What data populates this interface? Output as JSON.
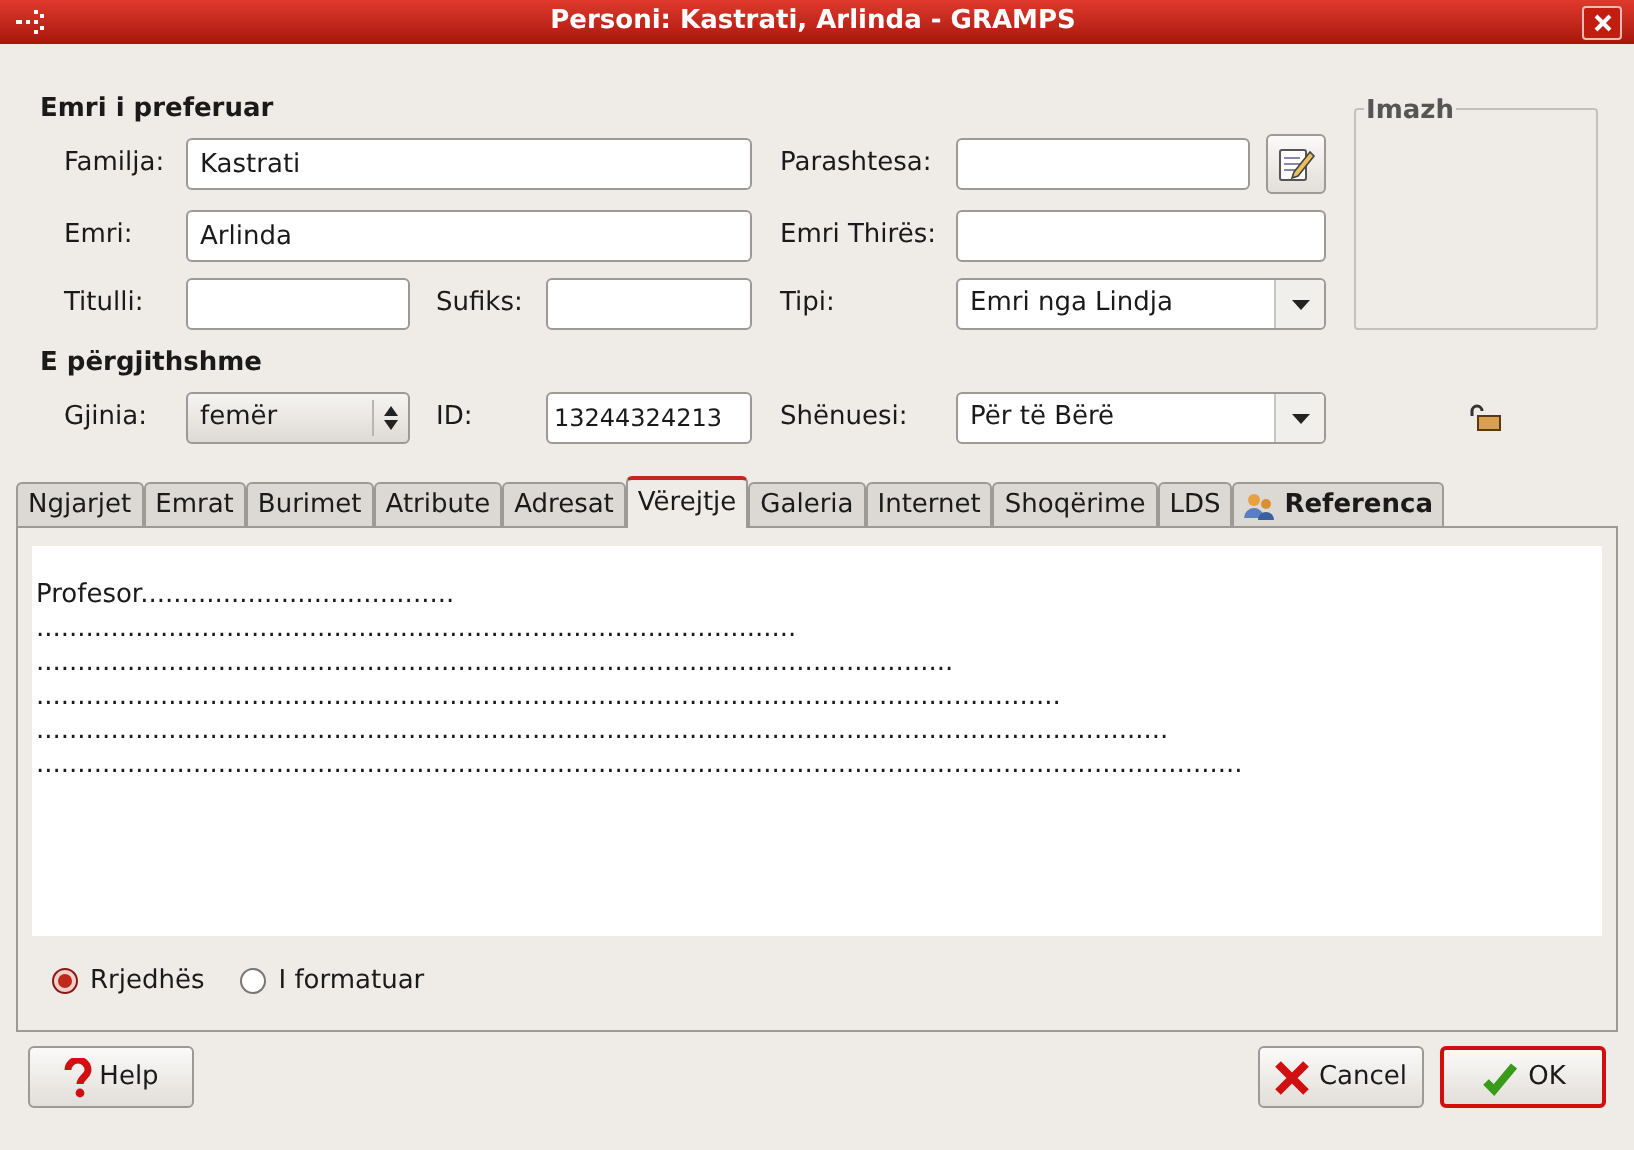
{
  "window": {
    "title": "Personi: Kastrati, Arlinda - GRAMPS"
  },
  "preferred_name": {
    "heading": "Emri i preferuar",
    "surname": {
      "label": "Familja:",
      "value": "Kastrati"
    },
    "prefix": {
      "label": "Parashtesa:"
    },
    "given": {
      "label": "Emri:",
      "value": "Arlinda"
    },
    "call_name": {
      "label": "Emri Thirës:"
    },
    "title": {
      "label": "Titulli:"
    },
    "suffix": {
      "label": "Sufiks:"
    },
    "type": {
      "label": "Tipi:",
      "value": "Emri nga Lindja"
    }
  },
  "image": {
    "label": "Imazh"
  },
  "general": {
    "heading": "E përgjithshme",
    "gender": {
      "label": "Gjinia:",
      "value": "femër"
    },
    "id": {
      "label": "ID:",
      "value": "13244324213"
    },
    "marker": {
      "label": "Shënuesi:",
      "value": "Për të Bërë"
    },
    "locked": false
  },
  "tabs": [
    {
      "label": "Ngjarjet",
      "selected": false,
      "kind": "plain"
    },
    {
      "label": "Emrat",
      "selected": false,
      "kind": "plain"
    },
    {
      "label": "Burimet",
      "selected": false,
      "kind": "plain"
    },
    {
      "label": "Atribute",
      "selected": false,
      "kind": "plain"
    },
    {
      "label": "Adresat",
      "selected": false,
      "kind": "plain"
    },
    {
      "label": "Vërejtje",
      "selected": true,
      "kind": "plain"
    },
    {
      "label": "Galeria",
      "selected": false,
      "kind": "plain"
    },
    {
      "label": "Internet",
      "selected": false,
      "kind": "plain"
    },
    {
      "label": "Shoqërime",
      "selected": false,
      "kind": "plain"
    },
    {
      "label": "LDS",
      "selected": false,
      "kind": "plain"
    },
    {
      "label": "Referenca",
      "selected": false,
      "kind": "reference"
    }
  ],
  "note": {
    "text": "Profesor......................................\n............................................................................................\n...............................................................................................................\n............................................................................................................................\n.........................................................................................................................................\n..................................................................................................................................................",
    "formats": [
      {
        "label": "Rrjedhës",
        "selected": true
      },
      {
        "label": "I formatuar",
        "selected": false
      }
    ]
  },
  "buttons": [
    {
      "label": "Help",
      "kind": "help",
      "focused": false
    },
    {
      "label": "Cancel",
      "kind": "cancel",
      "focused": false
    },
    {
      "label": "OK",
      "kind": "ok",
      "focused": true
    }
  ]
}
